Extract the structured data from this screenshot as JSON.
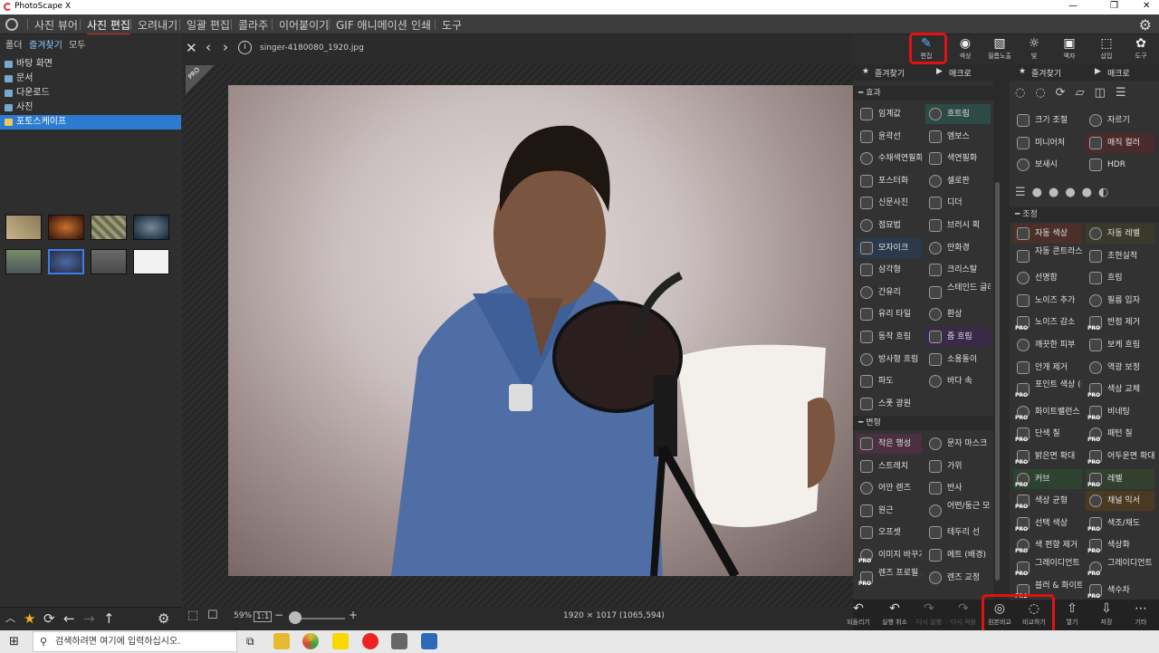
{
  "app": {
    "title": "PhotoScape X"
  },
  "menu": [
    "사진 뷰어",
    "사진 편집",
    "오려내기",
    "일괄 편집",
    "콜라주",
    "이어붙이기",
    "GIF 애니메이션",
    "인쇄",
    "도구"
  ],
  "left": {
    "tabs": [
      "폴더",
      "즐겨찾기",
      "모두"
    ],
    "items": [
      "바탕 화면",
      "문서",
      "다운로드",
      "사진",
      "포토스케이프"
    ]
  },
  "viewer": {
    "filename": "singer-4180080_1920.jpg",
    "zoom": "59%",
    "ratio": "1:1",
    "dimensions": "1920 × 1017 (1065,594)",
    "pro_badge": "PRO"
  },
  "toolbar": {
    "buttons": [
      "편집",
      "색상",
      "필름노출",
      "빛",
      "액자",
      "삽입",
      "도구"
    ]
  },
  "panel_left": {
    "head": [
      "즐겨찾기",
      "매크로"
    ],
    "effects_title": "효과",
    "effects": [
      "임계값",
      "흐트림",
      "윤곽선",
      "엠보스",
      "수채색연필화",
      "색연필화",
      "포스터화",
      "셀로판",
      "신문사진",
      "디더",
      "점묘법",
      "브러시 획",
      "모자이크",
      "만화경",
      "삼각형",
      "크리스탈",
      "간유리",
      "스테인드 글라스",
      "유리 타일",
      "환상",
      "동작 흐림",
      "줌 흐림",
      "방사형 흐림",
      "소용돌이",
      "파도",
      "바다 속",
      "스폿 광원"
    ],
    "transform_title": "변형",
    "transform": [
      "작은 행성",
      "문자 마스크",
      "스트레치",
      "가위",
      "어안 렌즈",
      "반사",
      "원근",
      "어떤/둥근 모퉁이",
      "오프셋",
      "테두리 선",
      "이미지 바꾸기",
      "메트 (배경)",
      "렌즈 프로필 교정",
      "렌즈 교정"
    ]
  },
  "panel_right": {
    "head": [
      "즐겨찾기",
      "매크로"
    ],
    "basic": [
      "크기 조절",
      "자르기",
      "미니어처",
      "매직 컬러",
      "보새시",
      "HDR"
    ],
    "adjust_title": "조정",
    "adjust": [
      "자동 색상",
      "자동 레벨",
      "자동 콘트라스트",
      "초현실적",
      "선명함",
      "흐림",
      "노이즈 추가",
      "필름 입자",
      "노이즈 감소",
      "반점 제거",
      "깨끗한 피부",
      "보케 흐림",
      "안개 제거",
      "역광 보정",
      "포인트 색상 (선택 색상 강조)",
      "색상 교체",
      "화이트밸런스",
      "비네팅",
      "단색 칠",
      "패턴 칠",
      "밝은면 확대",
      "어두운면 확대",
      "커브",
      "레벨",
      "색상 균형",
      "채널 믹서",
      "선택 색상",
      "색조/채도",
      "색 편향 제거",
      "색상화",
      "그레이디언트 칠",
      "그레이디언트 맵",
      "블러 & 화이트",
      "색수차"
    ]
  },
  "bottom": {
    "buttons": [
      "되돌리기",
      "실행 취소",
      "다시 실행",
      "다시 적용",
      "원본비교",
      "비교하기",
      "열기",
      "저장",
      "기타"
    ]
  },
  "taskbar": {
    "search": "검색하려면 여기에 입력하십시오."
  }
}
